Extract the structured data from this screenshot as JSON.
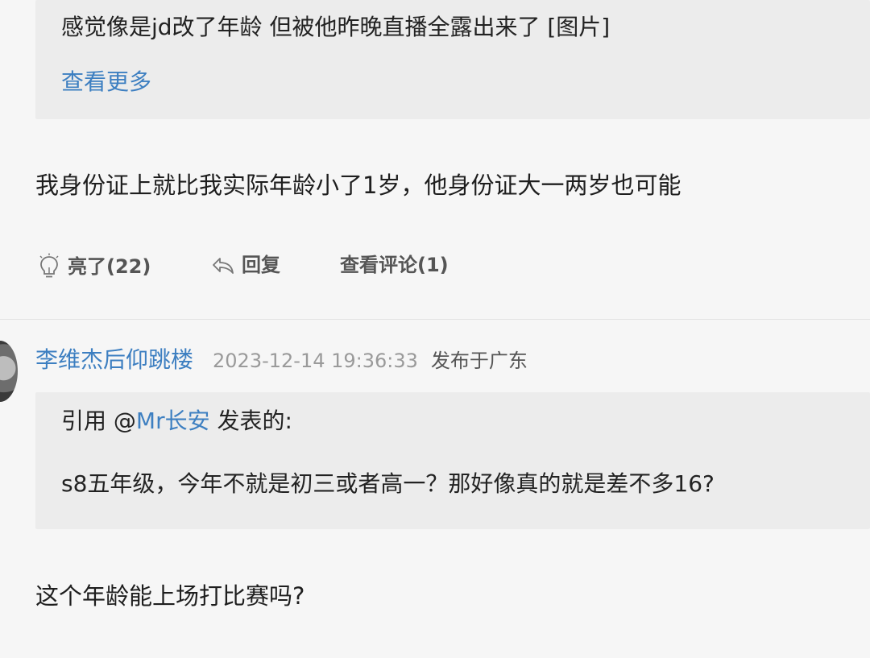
{
  "post1": {
    "quote_text": "感觉像是jd改了年龄 但被他昨晚直播全露出来了 [图片]",
    "more_label": "查看更多",
    "body": "我身份证上就比我实际年龄小了1岁，他身份证大一两岁也可能",
    "actions": {
      "like_label": "亮了(22)",
      "reply_label": "回复",
      "view_comments_label": "查看评论(1)"
    }
  },
  "post2": {
    "username": "李维杰后仰跳楼",
    "timestamp": "2023-12-14 19:36:33",
    "location": "发布于广东",
    "quote_prefix": "引用 @",
    "quote_mention": "Mr长安",
    "quote_suffix": " 发表的:",
    "quote_text": "s8五年级，今年不就是初三或者高一？那好像真的就是差不多16?",
    "body": "这个年龄能上场打比赛吗?"
  },
  "icons": {
    "like": "lightbulb-icon",
    "reply": "reply-arrow-icon"
  },
  "colors": {
    "link": "#3d7fc1",
    "quote_bg": "#ececec",
    "page_bg": "#f6f6f6",
    "timestamp": "#9a9a9a"
  }
}
